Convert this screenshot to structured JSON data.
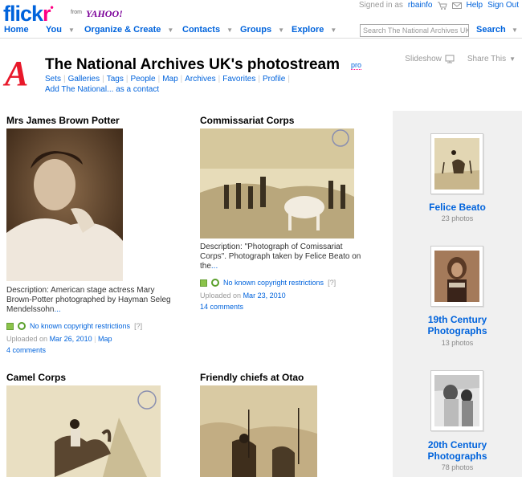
{
  "brand": {
    "logo_main": "flick",
    "logo_r": "r",
    "logo_dot": "•",
    "from": "from",
    "yahoo": "YAHOO!"
  },
  "userbar": {
    "signed_in_as": "Signed in as",
    "username": "rbainfo",
    "help": "Help",
    "sign_out": "Sign Out"
  },
  "nav": {
    "home": "Home",
    "you": "You",
    "organize": "Organize & Create",
    "contacts": "Contacts",
    "groups": "Groups",
    "explore": "Explore",
    "search_placeholder": "Search The National Archives UK's",
    "search_button": "Search"
  },
  "header": {
    "avatar_letter": "A",
    "title": "The National Archives UK's photostream",
    "pro_badge": "pro",
    "slideshow": "Slideshow",
    "share": "Share This",
    "subnav": [
      "Sets",
      "Galleries",
      "Tags",
      "People",
      "Map",
      "Archives",
      "Favorites",
      "Profile"
    ],
    "add_contact": "Add The National... as a contact"
  },
  "photos": [
    {
      "title": "Mrs James Brown Potter",
      "desc_line1": "Description: American stage actress Mary",
      "desc_line2": "Brown-Potter photographed by Hayman Seleg",
      "desc_line3": "Mendelssohn",
      "desc_more": "...",
      "license": "No known copyright restrictions",
      "license_q": "[?]",
      "uploaded_prefix": "Uploaded on",
      "uploaded_date": "Mar 26, 2010",
      "map": "Map",
      "comments": "4 comments"
    },
    {
      "title": "Commissariat Corps",
      "desc_line1": "Description: \"Photograph of Comissariat",
      "desc_line2": "Corps\". Photograph taken by Felice Beato on",
      "desc_line3": "the",
      "desc_more": "...",
      "license": "No known copyright restrictions",
      "license_q": "[?]",
      "uploaded_prefix": "Uploaded on",
      "uploaded_date": "Mar 23, 2010",
      "comments": "14 comments"
    },
    {
      "title": "Camel Corps"
    },
    {
      "title": "Friendly chiefs at Otao"
    }
  ],
  "sets": [
    {
      "title_line1": "Felice Beato",
      "title_line2": "",
      "count": "23 photos"
    },
    {
      "title_line1": "19th Century",
      "title_line2": "Photographs",
      "count": "13 photos"
    },
    {
      "title_line1": "20th Century",
      "title_line2": "Photographs",
      "count": "78 photos"
    }
  ],
  "colors": {
    "link": "#0063dc",
    "pink": "#ff0084",
    "sidebar_bg": "#f0f0f0"
  }
}
